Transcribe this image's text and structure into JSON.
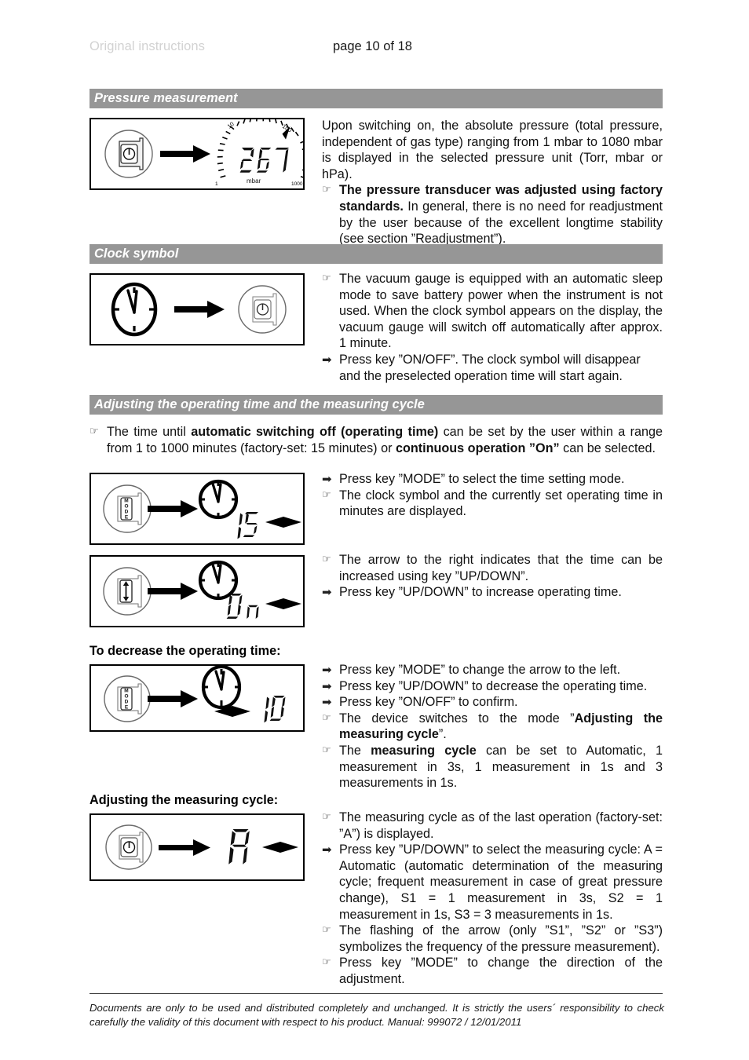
{
  "header": {
    "left_label": "Original instructions",
    "page_label": "page 10 of 18"
  },
  "bullets": {
    "info_glyph": "☞",
    "action_glyph": "➡"
  },
  "sections": [
    {
      "id": "pressure-measurement",
      "title": "Pressure measurement",
      "figure": {
        "type": "onoff-to-gauge",
        "key_icon": "onoff-key-icon",
        "gauge": {
          "value": "267",
          "unit": "mbar",
          "scale_labels": [
            "1",
            "10",
            "100",
            "1000"
          ]
        }
      },
      "blocks": [
        {
          "kind": "plain",
          "text": "Upon switching on, the absolute pressure (total pressure, independent of gas type) ranging from 1 mbar to 1080 mbar is displayed in the selected pressure unit (Torr, mbar or hPa)."
        },
        {
          "kind": "info",
          "html": "<b>The pressure transducer was adjusted using factory standards.</b> In general, there is no need for readjustment by the user because of the excellent longtime stability (see section ”Readjustment”)."
        }
      ]
    },
    {
      "id": "clock-symbol",
      "title": "Clock symbol",
      "figure": {
        "type": "clock-to-onoff",
        "key_icon": "onoff-key-icon",
        "clock_icon": "clock-icon"
      },
      "blocks": [
        {
          "kind": "info",
          "html": "The vacuum gauge is equipped with an automatic sleep mode to save battery power when the instrument is not used. When the clock symbol appears on the display, the vacuum gauge will switch off automatically after approx. 1 minute."
        },
        {
          "kind": "action",
          "html": "Press key ”ON/OFF”. The clock symbol will disappear and the preselected operation time will start again."
        }
      ]
    },
    {
      "id": "adjusting-operating-time",
      "title": "Adjusting the operating time and the measuring cycle",
      "intro": {
        "kind": "info",
        "html": "The time until <b>automatic switching off (operating time)</b> can be set by the user within a range from 1 to 1000 minutes (factory-set: 15 minutes) or <b>continuous operation ”On”</b> can be selected."
      }
    }
  ],
  "figures": {
    "fig_mode_15": {
      "key_label": "MODE",
      "key_icon": "mode-key-icon",
      "display_value": "15",
      "display_arrow": "right",
      "clock_icon": "clock-icon"
    },
    "fig_updown_on": {
      "key_label": "UP/DOWN",
      "key_icon": "updown-key-icon",
      "display_value": "On",
      "display_arrow": "right",
      "clock_icon": "clock-icon"
    },
    "fig_mode_10": {
      "key_label": "MODE",
      "key_icon": "mode-key-icon",
      "display_value": "10",
      "display_arrow": "left",
      "clock_icon": "clock-icon"
    },
    "fig_onoff_a": {
      "key_label": "ON/OFF",
      "key_icon": "onoff-key-icon",
      "display_value": "A",
      "display_arrow": "right"
    }
  },
  "blocks": {
    "mode_15": [
      {
        "kind": "action",
        "html": "Press key ”MODE” to select the time setting mode."
      },
      {
        "kind": "info",
        "html": "The clock symbol and the currently set operating time in minutes are displayed."
      }
    ],
    "updown_on": [
      {
        "kind": "info",
        "html": "The arrow to the right indicates that the time can be increased using key ”UP/DOWN”."
      },
      {
        "kind": "action",
        "html": "Press key ”UP/DOWN” to increase operating time."
      }
    ],
    "decrease": [
      {
        "kind": "action",
        "html": "Press key ”MODE” to change the arrow to the left."
      },
      {
        "kind": "action",
        "html": "Press key ”UP/DOWN” to decrease the operating time."
      },
      {
        "kind": "action",
        "html": "Press key ”ON/OFF” to confirm."
      },
      {
        "kind": "info",
        "html": "The device switches to the mode ”<b>Adjusting the measuring cycle</b>”."
      },
      {
        "kind": "info",
        "html": "The <b>measuring cycle</b> can be set to Automatic, 1 measurement in 3s, 1 measurement in 1s and 3 measurements in 1s."
      }
    ],
    "measuring_cycle": [
      {
        "kind": "info",
        "html": "The measuring cycle as of the last operation (factory-set: ”A”) is displayed."
      },
      {
        "kind": "action",
        "html": "Press key ”UP/DOWN” to select the measuring cycle: A = Automatic (automatic determination of the measuring cycle; frequent measurement in case of great pressure change), S1 = 1 measurement in 3s, S2 = 1 measurement in 1s, S3 = 3 measurements in 1s."
      },
      {
        "kind": "info",
        "html": "The flashing of the arrow (only ”S1”, ”S2” or ”S3”) symbolizes the frequency of the pressure measurement)."
      },
      {
        "kind": "info",
        "html": "Press key ”MODE” to change the direction of the adjustment."
      }
    ]
  },
  "subheads": {
    "decrease": "To decrease the operating time:",
    "measuring_cycle": "Adjusting the measuring cycle:"
  },
  "footer": {
    "text": "Documents are only to be used and distributed completely and unchanged. It is strictly the users´ responsibility to check carefully the validity of this document with respect to his product. Manual: 999072 / 12/01/2011"
  },
  "colors": {
    "section_bar": "#969696",
    "header_left": "#d2d2d2",
    "text": "#111111"
  }
}
